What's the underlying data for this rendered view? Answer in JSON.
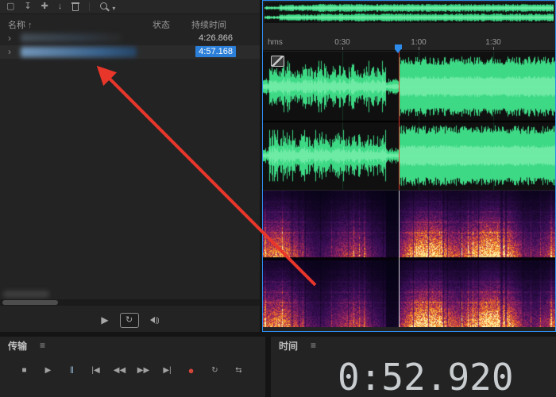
{
  "colors": {
    "accent": "#2d8ceb",
    "waveform_green": "#40e58c",
    "record_red": "#d5453a",
    "arrow_red": "#e8362b",
    "selection_blue": "#2b7fd9"
  },
  "files_panel": {
    "toolbar": {
      "icons": [
        {
          "name": "new-file",
          "glyph": "▢"
        },
        {
          "name": "import-file",
          "glyph": "↧"
        },
        {
          "name": "insert-into-multitrack",
          "glyph": "✚"
        },
        {
          "name": "export-file",
          "glyph": "↓"
        },
        {
          "name": "delete"
        },
        {
          "name": "search",
          "caret": "▾"
        }
      ]
    },
    "columns": {
      "name_label": "名称",
      "sort_indicator": "↑",
      "status_label": "状态",
      "duration_label": "持续时间"
    },
    "rows": [
      {
        "expander": "›",
        "status": "",
        "duration": "4:26.866",
        "selected": false
      },
      {
        "expander": "›",
        "status": "",
        "duration": "4:57.168",
        "selected": true
      }
    ],
    "preview": {
      "play_glyph": "▶",
      "loop_glyph": "↻",
      "speaker_waves": "))"
    }
  },
  "editor": {
    "ruler": {
      "unit": "hms",
      "ticks": [
        {
          "label": "0:30"
        },
        {
          "label": "1:00"
        },
        {
          "label": "1:30"
        }
      ]
    }
  },
  "transport": {
    "title": "传输",
    "menu_glyph": "≡",
    "buttons": [
      {
        "name": "stop",
        "glyph": "■"
      },
      {
        "name": "play",
        "glyph": "▶"
      },
      {
        "name": "pause",
        "glyph": "‖"
      },
      {
        "name": "skip-to-start",
        "glyph": "|◀"
      },
      {
        "name": "rewind",
        "glyph": "◀◀"
      },
      {
        "name": "fast-forward",
        "glyph": "▶▶"
      },
      {
        "name": "skip-to-end",
        "glyph": "▶|"
      },
      {
        "name": "record",
        "glyph": "●"
      },
      {
        "name": "loop-playback",
        "glyph": "↻"
      },
      {
        "name": "skip-selection",
        "glyph": "⇆"
      }
    ]
  },
  "time_panel": {
    "title": "时间",
    "menu_glyph": "≡",
    "value": "0:52.920"
  }
}
